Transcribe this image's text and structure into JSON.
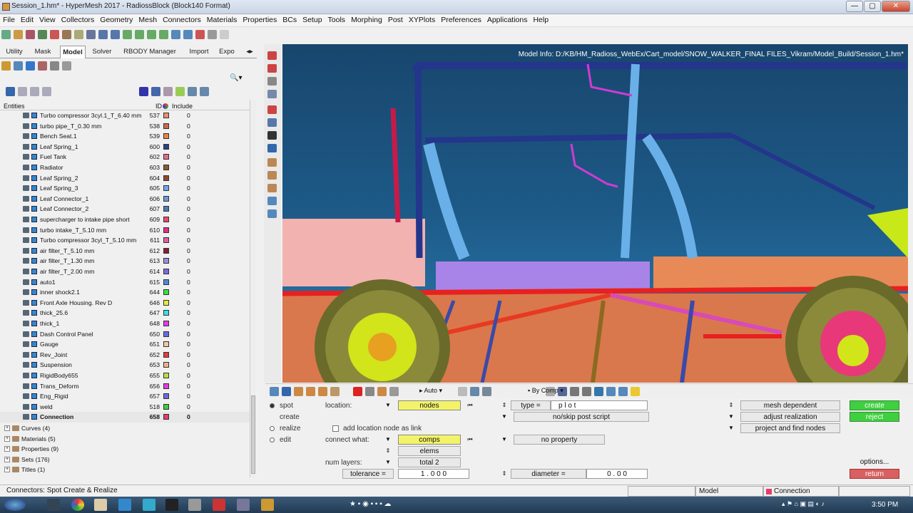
{
  "window": {
    "title": "Session_1.hm* - HyperMesh 2017 - RadiossBlock (Block140 Format)",
    "min": "—",
    "max": "▢",
    "close": "✕"
  },
  "menu": [
    "File",
    "Edit",
    "View",
    "Collectors",
    "Geometry",
    "Mesh",
    "Connectors",
    "Materials",
    "Properties",
    "BCs",
    "Setup",
    "Tools",
    "Morphing",
    "Post",
    "XYPlots",
    "Preferences",
    "Applications",
    "Help"
  ],
  "tabs": [
    "Utility",
    "Mask",
    "Model",
    "Solver",
    "RBODY Manager",
    "Import",
    "Expo"
  ],
  "entity_header": {
    "entities": "Entities",
    "id": "ID",
    "include": "Include"
  },
  "components": [
    {
      "name": "Turbo compressor 3cyl.1_T_6.40 mm",
      "id": "537",
      "color": "#e8906a",
      "inc": "0"
    },
    {
      "name": "turbo pipe_T_0.30 mm",
      "id": "538",
      "color": "#c86a4a",
      "inc": "0"
    },
    {
      "name": "Bench Seat.1",
      "id": "539",
      "color": "#e9824a",
      "inc": "0"
    },
    {
      "name": "Leaf Spring_1",
      "id": "600",
      "color": "#2a3f8c",
      "inc": "0"
    },
    {
      "name": "Fuel Tank",
      "id": "602",
      "color": "#e86a8a",
      "inc": "0"
    },
    {
      "name": "Radiator",
      "id": "603",
      "color": "#8a5a2a",
      "inc": "0"
    },
    {
      "name": "Leaf Spring_2",
      "id": "604",
      "color": "#8a4a2a",
      "inc": "0"
    },
    {
      "name": "Leaf Spring_3",
      "id": "605",
      "color": "#6aa8e8",
      "inc": "0"
    },
    {
      "name": "Leaf Connector_1",
      "id": "606",
      "color": "#6a9ad0",
      "inc": "0"
    },
    {
      "name": "Leaf Connector_2",
      "id": "607",
      "color": "#4a7ab8",
      "inc": "0"
    },
    {
      "name": "supercharger to intake pipe short",
      "id": "609",
      "color": "#e84a6a",
      "inc": "0"
    },
    {
      "name": "turbo intake_T_5.10 mm",
      "id": "610",
      "color": "#e82a8a",
      "inc": "0"
    },
    {
      "name": "Turbo compressor 3cyl_T_5.10 mm",
      "id": "611",
      "color": "#e85aa0",
      "inc": "0"
    },
    {
      "name": "air filter_T_5.10 mm",
      "id": "612",
      "color": "#8a1a3a",
      "inc": "0"
    },
    {
      "name": "air filter_T_1.30 mm",
      "id": "613",
      "color": "#9a8ae0",
      "inc": "0"
    },
    {
      "name": "air filter_T_2.00 mm",
      "id": "614",
      "color": "#7a6ae0",
      "inc": "0"
    },
    {
      "name": "auto1",
      "id": "615",
      "color": "#4a8ae0",
      "inc": "0"
    },
    {
      "name": "inner shock2.1",
      "id": "644",
      "color": "#3ae03a",
      "inc": "0"
    },
    {
      "name": "Front Axle Housing. Rev D",
      "id": "646",
      "color": "#e8e83a",
      "inc": "0"
    },
    {
      "name": "thick_25.6",
      "id": "647",
      "color": "#3ae0e0",
      "inc": "0"
    },
    {
      "name": "thick_1",
      "id": "648",
      "color": "#e83ae8",
      "inc": "0"
    },
    {
      "name": "Dash Control Panel",
      "id": "650",
      "color": "#6a6ae0",
      "inc": "0"
    },
    {
      "name": "Gauge",
      "id": "651",
      "color": "#f0c8a0",
      "inc": "0"
    },
    {
      "name": "Rev_Joint",
      "id": "652",
      "color": "#e83a3a",
      "inc": "0"
    },
    {
      "name": "Suspension",
      "id": "653",
      "color": "#f0b090",
      "inc": "0"
    },
    {
      "name": "RigidBody655",
      "id": "655",
      "color": "#b8e040",
      "inc": "0"
    },
    {
      "name": "Trans_Deform",
      "id": "656",
      "color": "#e03ae8",
      "inc": "0"
    },
    {
      "name": "Eng_Rigid",
      "id": "657",
      "color": "#6a6ae0",
      "inc": "0"
    },
    {
      "name": "weld",
      "id": "518",
      "color": "#3ad03a",
      "inc": "0"
    },
    {
      "name": "Connection",
      "id": "658",
      "color": "#e83a6a",
      "inc": "0"
    }
  ],
  "tree": [
    "Curves (4)",
    "Materials (5)",
    "Properties (9)",
    "Sets (176)",
    "Titles (1)"
  ],
  "viewport": {
    "model_info": "Model Info: D:/KB/HM_Radioss_WebEx/Cart_model/SNOW_WALKER_FINAL FILES_Vikram/Model_Build/Session_1.hm*"
  },
  "toolbar2": {
    "auto": "Auto",
    "bycomp": "By Comp"
  },
  "panel": {
    "spot": "spot",
    "create": "create",
    "realize": "realize",
    "edit": "edit",
    "location_label": "location:",
    "location_val": "nodes",
    "add_location": "add location node as link",
    "connect_label": "connect what:",
    "connect_val": "comps",
    "elems": "elems",
    "layers_label": "num layers:",
    "layers_val": "total 2",
    "tol_label": "tolerance =",
    "tol_val": "1 . 0 0 0",
    "type_label": "type =",
    "type_val": "p l o t",
    "noskip": "no/skip post script",
    "noprop": "no property",
    "diam_label": "diameter =",
    "diam_val": "0 . 0 0",
    "mesh_dep": "mesh dependent",
    "adjust": "adjust realization",
    "project": "project and find nodes",
    "create_btn": "create",
    "reject_btn": "reject",
    "options": "options...",
    "return_btn": "return"
  },
  "status": {
    "left": "Connectors: Spot Create & Realize",
    "model": "Model",
    "conn": "Connection"
  },
  "taskbar": {
    "time": "3:50 PM"
  }
}
